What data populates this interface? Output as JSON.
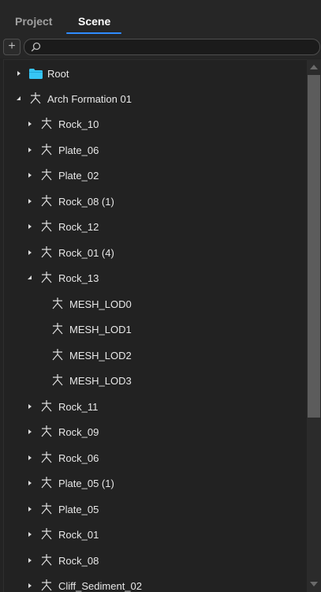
{
  "tabs": [
    {
      "label": "Project",
      "active": false
    },
    {
      "label": "Scene",
      "active": true
    }
  ],
  "toolbar": {
    "add_label": "+",
    "search_value": "",
    "search_placeholder": ""
  },
  "colors": {
    "accent": "#2f8bff",
    "folder": "#37c5f5",
    "background": "#232323"
  },
  "tree": {
    "items": [
      {
        "label": "Root",
        "icon": "folder-icon",
        "arrow": "collapsed"
      },
      {
        "label": "Arch Formation 01",
        "icon": "node-icon",
        "arrow": "expanded"
      },
      {
        "label": "Rock_10",
        "icon": "node-icon",
        "arrow": "collapsed"
      },
      {
        "label": "Plate_06",
        "icon": "node-icon",
        "arrow": "collapsed"
      },
      {
        "label": "Plate_02",
        "icon": "node-icon",
        "arrow": "collapsed"
      },
      {
        "label": "Rock_08 (1)",
        "icon": "node-icon",
        "arrow": "collapsed"
      },
      {
        "label": "Rock_12",
        "icon": "node-icon",
        "arrow": "collapsed"
      },
      {
        "label": "Rock_01 (4)",
        "icon": "node-icon",
        "arrow": "collapsed"
      },
      {
        "label": "Rock_13",
        "icon": "node-icon",
        "arrow": "expanded"
      },
      {
        "label": "MESH_LOD0",
        "icon": "node-icon",
        "arrow": "none"
      },
      {
        "label": "MESH_LOD1",
        "icon": "node-icon",
        "arrow": "none"
      },
      {
        "label": "MESH_LOD2",
        "icon": "node-icon",
        "arrow": "none"
      },
      {
        "label": "MESH_LOD3",
        "icon": "node-icon",
        "arrow": "none"
      },
      {
        "label": "Rock_11",
        "icon": "node-icon",
        "arrow": "collapsed"
      },
      {
        "label": "Rock_09",
        "icon": "node-icon",
        "arrow": "collapsed"
      },
      {
        "label": "Rock_06",
        "icon": "node-icon",
        "arrow": "collapsed"
      },
      {
        "label": "Plate_05 (1)",
        "icon": "node-icon",
        "arrow": "collapsed"
      },
      {
        "label": "Plate_05",
        "icon": "node-icon",
        "arrow": "collapsed"
      },
      {
        "label": "Rock_01",
        "icon": "node-icon",
        "arrow": "collapsed"
      },
      {
        "label": "Rock_08",
        "icon": "node-icon",
        "arrow": "collapsed"
      },
      {
        "label": "Cliff_Sediment_02",
        "icon": "node-icon",
        "arrow": "collapsed"
      }
    ]
  }
}
